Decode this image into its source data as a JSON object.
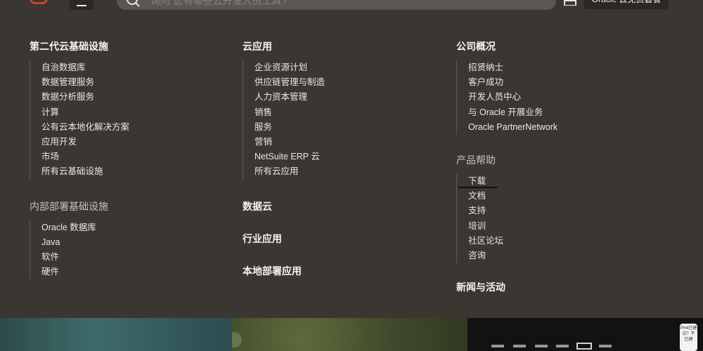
{
  "header": {
    "search_placeholder": "询问“您有哪些云开发人员工具?”",
    "trial_button": "Oracle 云免费套餐"
  },
  "columns": [
    {
      "sections": [
        {
          "heading": "第二代云基础设施",
          "items": [
            "自治数据库",
            "数据管理服务",
            "数据分析服务",
            "计算",
            "公有云本地化解决方案",
            "应用开发",
            "市场",
            "所有云基础设施"
          ]
        },
        {
          "heading": "内部部署基础设施",
          "items": [
            "Oracle 数据库",
            "Java",
            "软件",
            "硬件"
          ]
        }
      ]
    },
    {
      "sections": [
        {
          "heading": "云应用",
          "items": [
            "企业资源计划",
            "供应链管理与制造",
            "人力资本管理",
            "销售",
            "服务",
            "营销",
            "NetSuite ERP 云",
            "所有云应用"
          ]
        },
        {
          "heading": "数据云"
        },
        {
          "heading": "行业应用"
        },
        {
          "heading": "本地部署应用"
        }
      ]
    },
    {
      "sections": [
        {
          "heading": "公司概况",
          "items": [
            "招贤纳士",
            "客户成功",
            "开发人员中心",
            "与 Oracle 开展业务",
            "Oracle PartnerNetwork"
          ]
        },
        {
          "heading": "产品帮助",
          "items": [
            "下载",
            "文档",
            "支持",
            "培训",
            "社区论坛",
            "咨询"
          ]
        },
        {
          "heading": "新闻与活动"
        }
      ]
    }
  ],
  "chat_widget": {
    "line1": "PH4已建",
    "line2": "议？不",
    "line3": "已建"
  }
}
